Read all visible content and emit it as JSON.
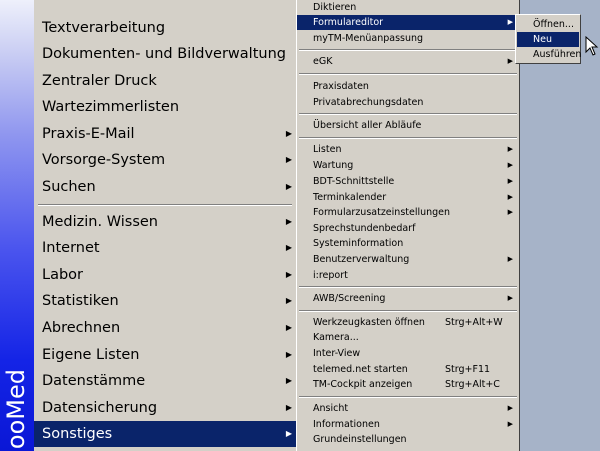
{
  "brand": {
    "text": "ooMed"
  },
  "main_menu": {
    "items": [
      {
        "label": "Textverarbeitung",
        "has_submenu": false
      },
      {
        "label": "Dokumenten- und Bildverwaltung",
        "has_submenu": false
      },
      {
        "label": "Zentraler Druck",
        "has_submenu": false
      },
      {
        "label": "Wartezimmerlisten",
        "has_submenu": false
      },
      {
        "label": "Praxis-E-Mail",
        "has_submenu": true
      },
      {
        "label": "Vorsorge-System",
        "has_submenu": true
      },
      {
        "label": "Suchen",
        "has_submenu": true
      },
      {
        "label": "Medizin. Wissen",
        "has_submenu": true
      },
      {
        "label": "Internet",
        "has_submenu": true
      },
      {
        "label": "Labor",
        "has_submenu": true
      },
      {
        "label": "Statistiken",
        "has_submenu": true
      },
      {
        "label": "Abrechnen",
        "has_submenu": true
      },
      {
        "label": "Eigene Listen",
        "has_submenu": true
      },
      {
        "label": "Datenstämme",
        "has_submenu": true
      },
      {
        "label": "Datensicherung",
        "has_submenu": true
      },
      {
        "label": "Sonstiges",
        "has_submenu": true,
        "selected": true
      }
    ]
  },
  "submenu1": {
    "items": [
      {
        "label": "Diktieren"
      },
      {
        "label": "Formulareditor",
        "has_submenu": true,
        "selected": true
      },
      {
        "label": "myTM-Menüanpassung"
      },
      {
        "label": "eGK",
        "has_submenu": true
      },
      {
        "label": "Praxisdaten"
      },
      {
        "label": "Privatabrechungsdaten"
      },
      {
        "label": "Übersicht aller Abläufe"
      },
      {
        "label": "Listen",
        "has_submenu": true
      },
      {
        "label": "Wartung",
        "has_submenu": true
      },
      {
        "label": "BDT-Schnittstelle",
        "has_submenu": true
      },
      {
        "label": "Terminkalender",
        "has_submenu": true
      },
      {
        "label": "Formularzusatzeinstellungen",
        "has_submenu": true
      },
      {
        "label": "Sprechstundenbedarf"
      },
      {
        "label": "Systeminformation"
      },
      {
        "label": "Benutzerverwaltung",
        "has_submenu": true
      },
      {
        "label": "i:report"
      },
      {
        "label": "AWB/Screening",
        "has_submenu": true
      },
      {
        "label": "Werkzeugkasten öffnen",
        "shortcut": "Strg+Alt+W"
      },
      {
        "label": "Kamera..."
      },
      {
        "label": "Inter-View"
      },
      {
        "label": "telemed.net starten",
        "shortcut": "Strg+F11"
      },
      {
        "label": "TM-Cockpit anzeigen",
        "shortcut": "Strg+Alt+C"
      },
      {
        "label": "Ansicht",
        "has_submenu": true
      },
      {
        "label": "Informationen",
        "has_submenu": true
      },
      {
        "label": "Grundeinstellungen"
      }
    ]
  },
  "submenu2": {
    "items": [
      {
        "label": "Öffnen..."
      },
      {
        "label": "Neu",
        "selected": true
      },
      {
        "label": "Ausführen"
      }
    ]
  },
  "colors": {
    "menu_bg": "#d4d0c8",
    "highlight": "#0a246a",
    "desktop": "#a6b3c8"
  }
}
